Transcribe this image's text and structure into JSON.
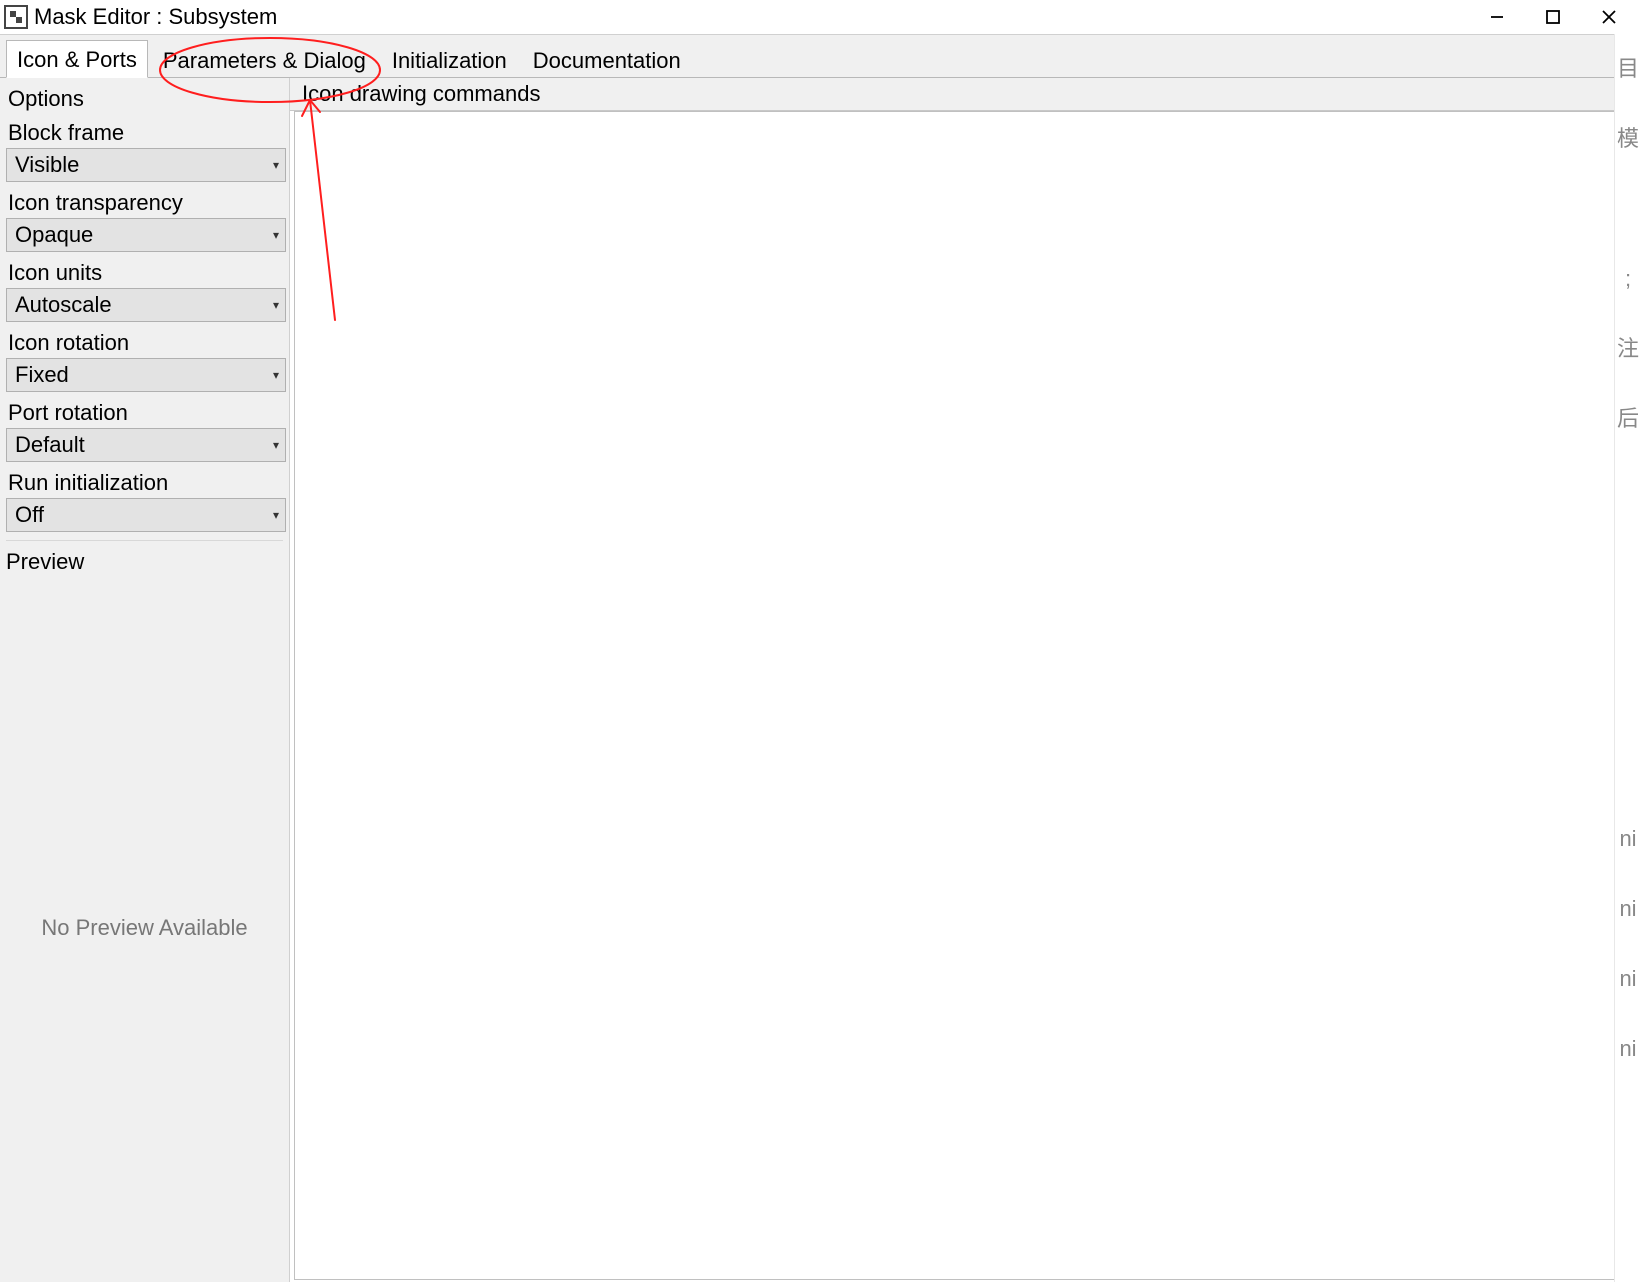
{
  "window": {
    "title": "Mask Editor : Subsystem"
  },
  "tabs": [
    {
      "label": "Icon & Ports",
      "active": true
    },
    {
      "label": "Parameters & Dialog",
      "active": false
    },
    {
      "label": "Initialization",
      "active": false
    },
    {
      "label": "Documentation",
      "active": false
    }
  ],
  "sidebar": {
    "options_header": "Options",
    "block_frame": {
      "label": "Block frame",
      "value": "Visible"
    },
    "icon_transparency": {
      "label": "Icon transparency",
      "value": "Opaque"
    },
    "icon_units": {
      "label": "Icon units",
      "value": "Autoscale"
    },
    "icon_rotation": {
      "label": "Icon rotation",
      "value": "Fixed"
    },
    "port_rotation": {
      "label": "Port rotation",
      "value": "Default"
    },
    "run_init": {
      "label": "Run initialization",
      "value": "Off"
    },
    "preview_header": "Preview",
    "preview_placeholder": "No Preview Available"
  },
  "editor": {
    "header": "Icon drawing commands",
    "content": ""
  }
}
